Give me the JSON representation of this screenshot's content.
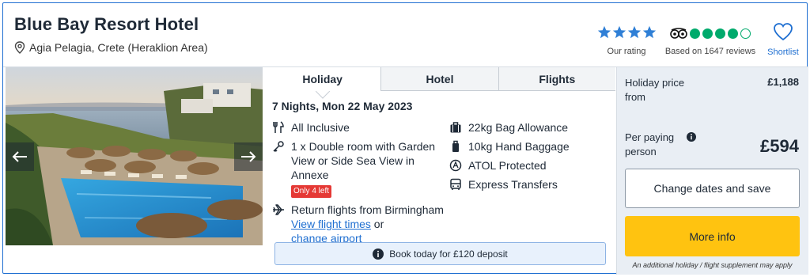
{
  "hotel": {
    "name": "Blue Bay Resort Hotel",
    "location": "Agia Pelagia, Crete (Heraklion Area)"
  },
  "rating": {
    "stars": 4,
    "label": "Our rating",
    "star_color": "#2f7fd6"
  },
  "tripadvisor": {
    "score_dots_filled": 4,
    "score_dots_total": 5,
    "label": "Based on 1647 reviews",
    "color": "#00aa6c"
  },
  "shortlist": {
    "label": "Shortlist"
  },
  "photo": {
    "prev_icon": "arrow-left-icon",
    "next_icon": "arrow-right-icon"
  },
  "tabs": [
    {
      "label": "Holiday",
      "active": true
    },
    {
      "label": "Hotel",
      "active": false
    },
    {
      "label": "Flights",
      "active": false
    }
  ],
  "details": {
    "dates": "7 Nights, Mon 22 May 2023",
    "board": "All Inclusive",
    "room": "1 x Double room with Garden View or Side Sea View in Annexe",
    "room_badge": "Only 4 left",
    "flights": "Return flights from Birmingham",
    "flight_times_link": "View flight times",
    "or_text": "or",
    "change_airport_link": "change airport",
    "bag": "22kg Bag Allowance",
    "hand_baggage": "10kg Hand Baggage",
    "atol": "ATOL Protected",
    "transfers": "Express Transfers"
  },
  "deposit": {
    "text": "Book today for £120 deposit"
  },
  "price": {
    "holiday_label": "Holiday price from",
    "holiday_value": "£1,188",
    "per_person_label": "Per paying person",
    "per_person_value": "£594",
    "change_dates_label": "Change dates and save",
    "more_info_label": "More info",
    "note": "An additional holiday / flight supplement may apply",
    "accent": "#ffc310"
  }
}
